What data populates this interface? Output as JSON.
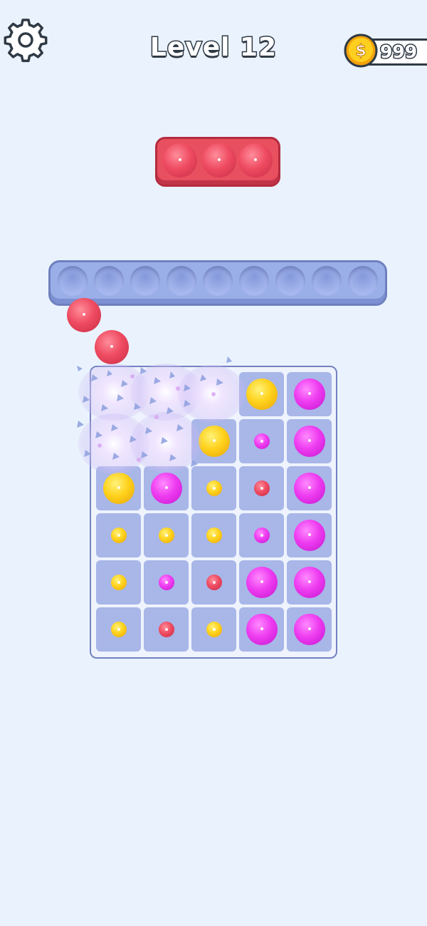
{
  "header": {
    "settings_icon": "gear-icon",
    "level_label": "Level 12",
    "coin_icon": "dollar-coin-icon",
    "coins": "999"
  },
  "target_tray": {
    "color": "#e8505f",
    "balls": [
      "pink",
      "pink",
      "pink"
    ]
  },
  "holding_bar": {
    "slots_total": 9,
    "slots_filled": 0
  },
  "moving_balls": [
    "pink",
    "pink"
  ],
  "board": {
    "columns": 5,
    "rows": 6,
    "grid": [
      [
        null,
        null,
        null,
        {
          "color": "yellow",
          "size": "large"
        },
        {
          "color": "magenta",
          "size": "large"
        }
      ],
      [
        null,
        null,
        {
          "color": "yellow",
          "size": "large"
        },
        {
          "color": "magenta",
          "size": "small"
        },
        {
          "color": "magenta",
          "size": "large"
        }
      ],
      [
        {
          "color": "yellow",
          "size": "large"
        },
        {
          "color": "magenta",
          "size": "large"
        },
        {
          "color": "yellow",
          "size": "small"
        },
        {
          "color": "pink",
          "size": "small"
        },
        {
          "color": "magenta",
          "size": "large"
        }
      ],
      [
        {
          "color": "yellow",
          "size": "small"
        },
        {
          "color": "yellow",
          "size": "small"
        },
        {
          "color": "yellow",
          "size": "small"
        },
        {
          "color": "magenta",
          "size": "small"
        },
        {
          "color": "magenta",
          "size": "large"
        }
      ],
      [
        {
          "color": "yellow",
          "size": "small"
        },
        {
          "color": "magenta",
          "size": "small"
        },
        {
          "color": "pink",
          "size": "small"
        },
        {
          "color": "magenta",
          "size": "large"
        },
        {
          "color": "magenta",
          "size": "large"
        }
      ],
      [
        {
          "color": "yellow",
          "size": "small"
        },
        {
          "color": "pink",
          "size": "small"
        },
        {
          "color": "yellow",
          "size": "small"
        },
        {
          "color": "magenta",
          "size": "large"
        },
        {
          "color": "magenta",
          "size": "large"
        }
      ]
    ],
    "breaking_cells": [
      [
        0,
        0
      ],
      [
        0,
        1
      ],
      [
        0,
        2
      ],
      [
        1,
        0
      ],
      [
        1,
        1
      ]
    ]
  },
  "colors": {
    "background": "#eaf3fd",
    "pink": "#ef4c62",
    "yellow": "#ffd21c",
    "magenta": "#ee3cf0",
    "cell": "#a8b6e8"
  }
}
